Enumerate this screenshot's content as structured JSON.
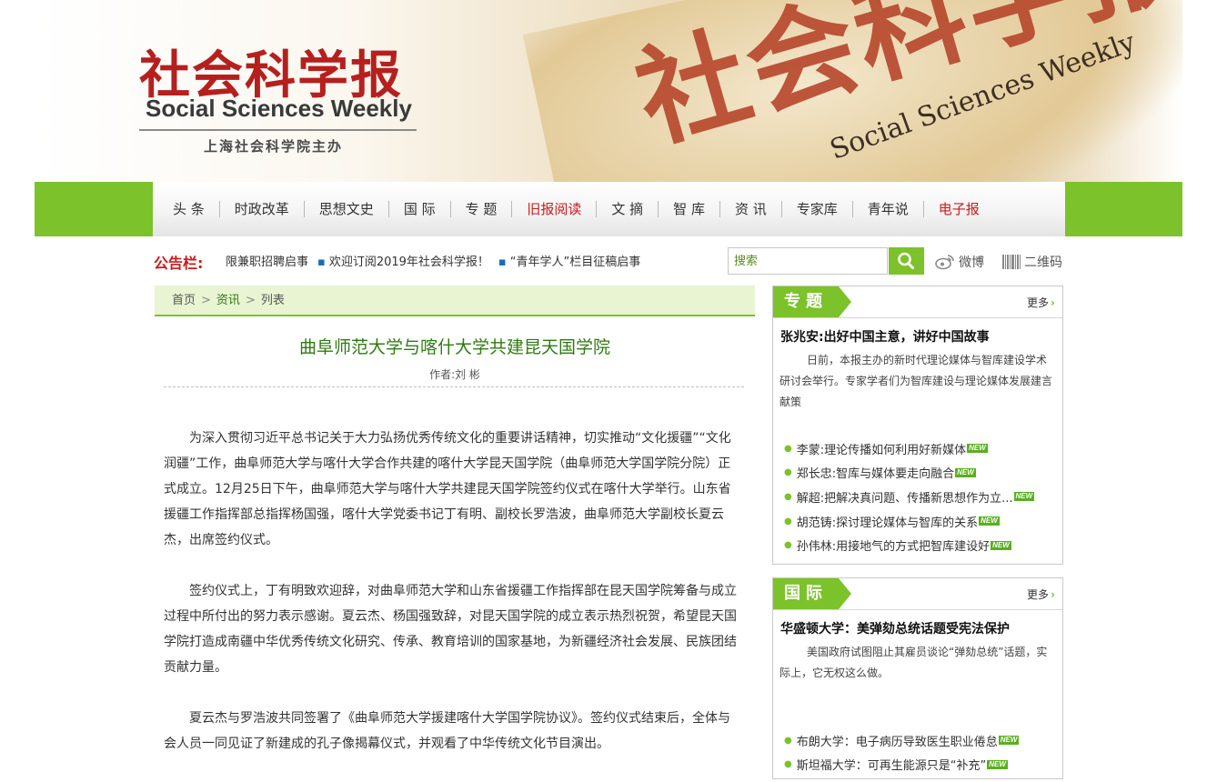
{
  "header": {
    "logo_cn": "社会科学报",
    "logo_en": "Social Sciences Weekly",
    "sponsor": "上海社会科学院主办",
    "banner_title": "社会科学报",
    "banner_subtitle": "Social Sciences Weekly"
  },
  "nav": {
    "items": [
      {
        "label": "头 条",
        "highlight": false
      },
      {
        "label": "时政改革",
        "highlight": false
      },
      {
        "label": "思想文史",
        "highlight": false
      },
      {
        "label": "国 际",
        "highlight": false
      },
      {
        "label": "专 题",
        "highlight": false
      },
      {
        "label": "旧报阅读",
        "highlight": true
      },
      {
        "label": "文 摘",
        "highlight": false
      },
      {
        "label": "智 库",
        "highlight": false
      },
      {
        "label": "资 讯",
        "highlight": false
      },
      {
        "label": "专家库",
        "highlight": false
      },
      {
        "label": "青年说",
        "highlight": false
      },
      {
        "label": "电子报",
        "highlight": true
      }
    ]
  },
  "notice": {
    "label": "公告栏:",
    "items": [
      "限兼职招聘启事",
      "欢迎订阅2019年社会科学报！",
      "“青年学人”栏目征稿启事"
    ]
  },
  "search": {
    "placeholder": "搜索",
    "weibo_label": "微博",
    "qrcode_label": "二维码"
  },
  "breadcrumb": {
    "home": "首页",
    "section": "资讯",
    "current": "列表"
  },
  "article": {
    "title": "曲阜师范大学与喀什大学共建昆天国学院",
    "author": "作者:刘 彬",
    "paragraphs": [
      "为深入贯彻习近平总书记关于大力弘扬优秀传统文化的重要讲话精神，切实推动“文化援疆”“文化润疆”工作，曲阜师范大学与喀什大学合作共建的喀什大学昆天国学院（曲阜师范大学国学院分院）正式成立。12月25日下午，曲阜师范大学与喀什大学共建昆天国学院签约仪式在喀什大学举行。山东省援疆工作指挥部总指挥杨国强，喀什大学党委书记丁有明、副校长罗浩波，曲阜师范大学副校长夏云杰，出席签约仪式。",
      "签约仪式上，丁有明致欢迎辞，对曲阜师范大学和山东省援疆工作指挥部在昆天国学院筹备与成立过程中所付出的努力表示感谢。夏云杰、杨国强致辞，对昆天国学院的成立表示热烈祝贺，希望昆天国学院打造成南疆中华优秀传统文化研究、传承、教育培训的国家基地，为新疆经济社会发展、民族团结贡献力量。",
      "夏云杰与罗浩波共同签署了《曲阜师范大学援建喀什大学国学院协议》。签约仪式结束后，全体与会人员一同见证了新建成的孔子像揭幕仪式，并观看了中华传统文化节目演出。"
    ]
  },
  "sidebar": {
    "special": {
      "tag": "专题",
      "more": "更多",
      "lead_title": "张兆安:出好中国主意，讲好中国故事",
      "lead_desc": "日前，本报主办的新时代理论媒体与智库建设学术研讨会举行。专家学者们为智库建设与理论媒体发展建言献策",
      "items": [
        "李蒙:理论传播如何利用好新媒体",
        "郑长忠:智库与媒体要走向融合",
        "解超:把解决真问题、传播新思想作为立...",
        "胡范铸:探讨理论媒体与智库的关系",
        "孙伟林:用接地气的方式把智库建设好"
      ],
      "badge": "NEW"
    },
    "intl": {
      "tag": "国际",
      "more": "更多",
      "lead_title": "华盛顿大学：美弹劾总统话题受宪法保护",
      "lead_desc": "美国政府试图阻止其雇员谈论“弹劾总统”话题，实际上，它无权这么做。",
      "items": [
        "布朗大学：电子病历导致医生职业倦怠",
        "斯坦福大学：可再生能源只是“补充”"
      ],
      "badge": "NEW"
    }
  },
  "colors": {
    "brand_green": "#7cc22a",
    "title_green": "#2f7b12",
    "accent_red": "#cc1a1a"
  }
}
